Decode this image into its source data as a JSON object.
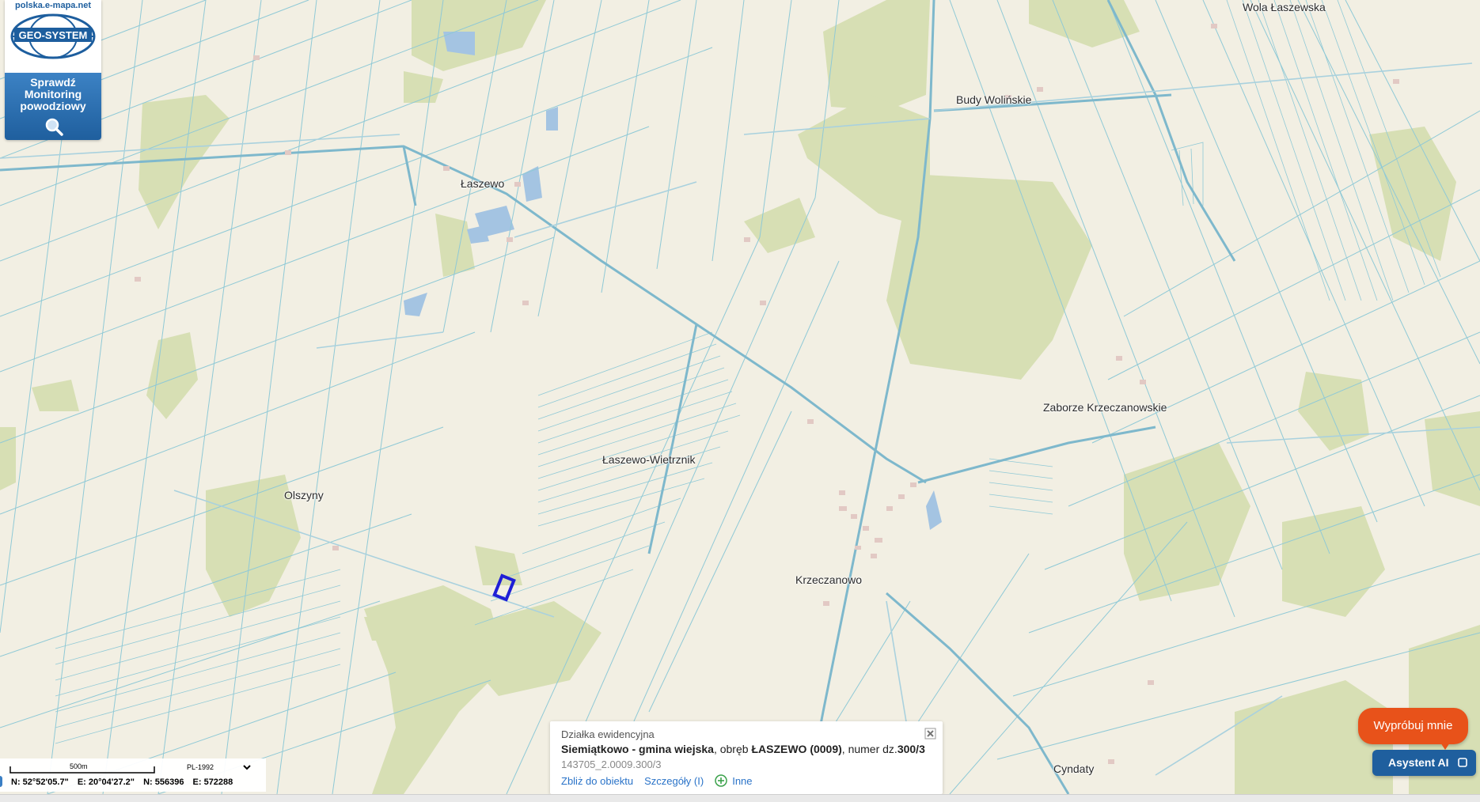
{
  "brand": {
    "url": "polska.e-mapa.net",
    "logo_text": "GEO-SYSTEM",
    "promo_lines": [
      "Sprawdź",
      "Monitoring",
      "powodziowy"
    ],
    "promo_icon": "magnifier-icon"
  },
  "map": {
    "place_labels": [
      {
        "name": "Wola Łaszewska"
      },
      {
        "name": "Budy Wolińskie"
      },
      {
        "name": "Łaszewo"
      },
      {
        "name": "Zaborze Krzeczanowskie"
      },
      {
        "name": "Łaszewo-Wietrznik"
      },
      {
        "name": "Olszyny"
      },
      {
        "name": "Krzeczanowo"
      },
      {
        "name": "Cyndaty"
      }
    ],
    "colors": {
      "land": "#f2efe3",
      "field_lines": "#8fc9d6",
      "road": "#7eb8cc",
      "forest": "#d7dfb4",
      "water": "#a4c4e2",
      "parcel_highlight": "#1f1fd6"
    }
  },
  "scale": {
    "label": "500m",
    "crs": "PL-1992",
    "crs_options": [
      "PL-1992"
    ],
    "lat": "N: 52°52'05.7\"",
    "lon": "E: 20°04'27.2\"",
    "northing": "N: 556396",
    "easting": "E: 572288"
  },
  "parcel_info": {
    "title": "Działka ewidencyjna",
    "gmina": "Siemiątkowo - gmina wiejska",
    "obreb_prefix": ", obręb ",
    "obreb": "ŁASZEWO (0009)",
    "numer_prefix": ", numer dz.",
    "numer": "300/3",
    "teryt_id": "143705_2.0009.300/3",
    "links": {
      "zoom": "Zbliż do obiektu",
      "details": "Szczegóły (I)",
      "other": "Inne"
    },
    "close_icon": "close-icon"
  },
  "assistant": {
    "try_label": "Wypróbuj mnie",
    "ai_label": "Asystent AI",
    "ai_icon": "chat-icon"
  }
}
